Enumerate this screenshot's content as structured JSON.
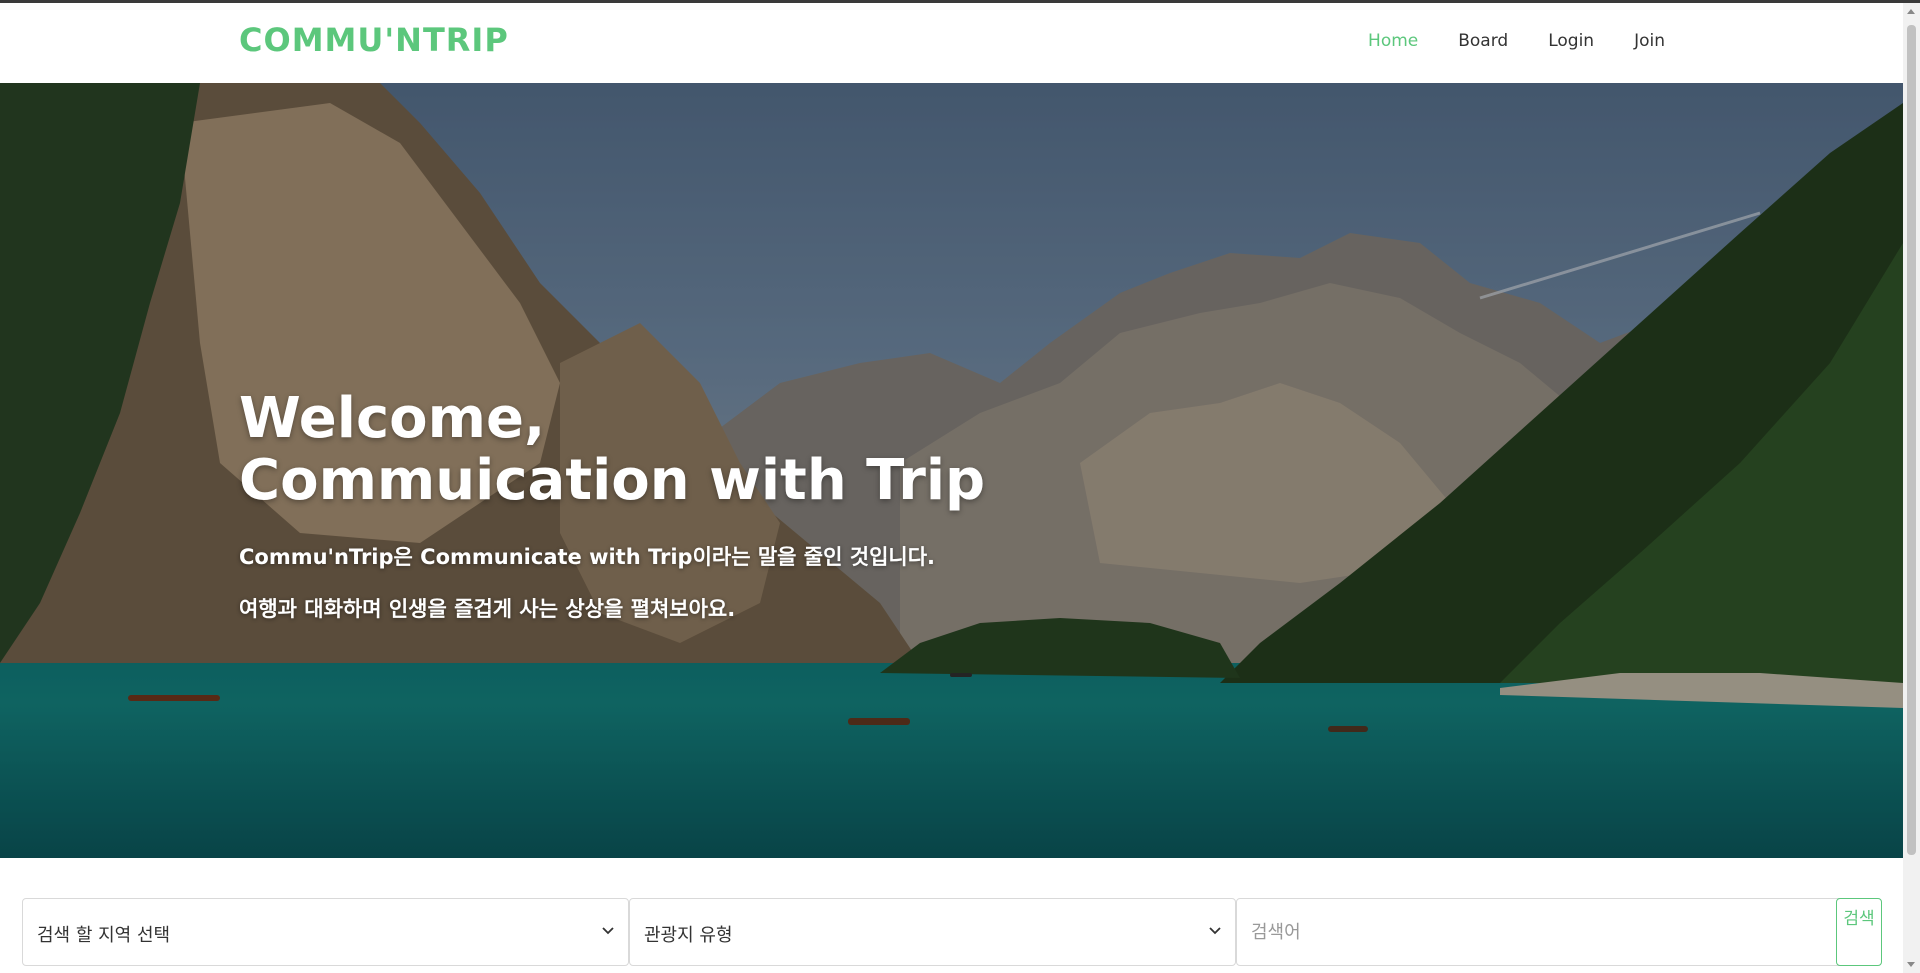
{
  "brand": "COMMU'NTRIP",
  "nav": {
    "items": [
      {
        "label": "Home",
        "active": true
      },
      {
        "label": "Board",
        "active": false
      },
      {
        "label": "Login",
        "active": false
      },
      {
        "label": "Join",
        "active": false
      }
    ]
  },
  "hero": {
    "title_line1": "Welcome,",
    "title_line2": "Commuication with Trip",
    "subtitle1": "Commu'nTrip은 Communicate with Trip이라는 말을 줄인 것입니다.",
    "subtitle2": "여행과 대화하며 인생을 즐겁게 사는 상상을 펼쳐보아요."
  },
  "search": {
    "region_select": "검색 할 지역 선택",
    "type_select": "관광지 유형",
    "keyword_placeholder": "검색어",
    "button_label": "검색"
  },
  "colors": {
    "accent": "#5cc77c",
    "nav_text": "#333333"
  },
  "icons": [
    "chevron-down-icon"
  ]
}
